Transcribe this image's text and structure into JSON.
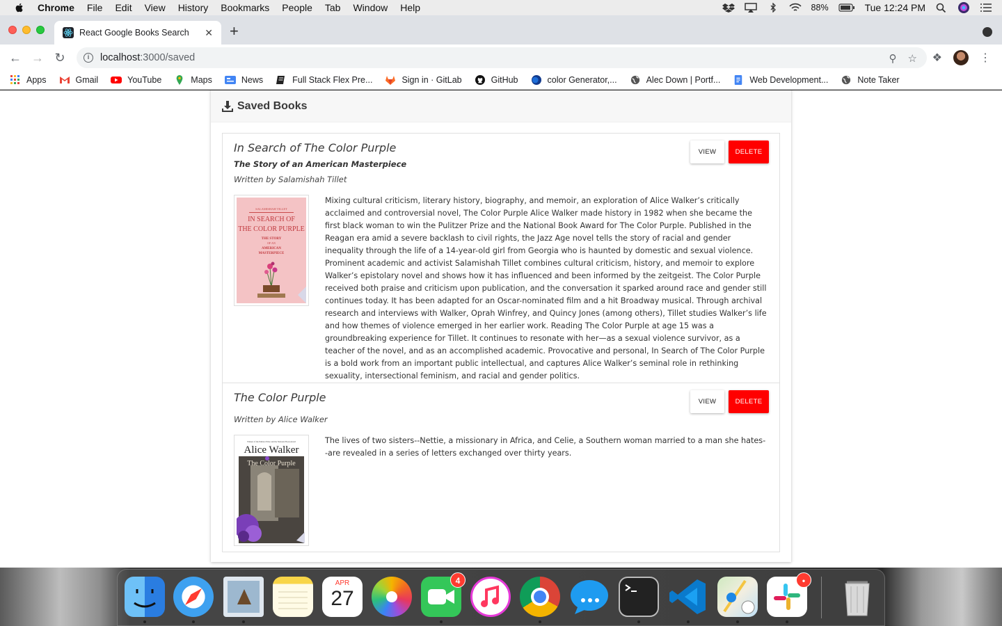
{
  "menubar": {
    "app": "Chrome",
    "items": [
      "File",
      "Edit",
      "View",
      "History",
      "Bookmarks",
      "People",
      "Tab",
      "Window",
      "Help"
    ],
    "battery": "88%",
    "clock": "Tue 12:24 PM"
  },
  "tab": {
    "title": "React Google Books Search",
    "close": "✕"
  },
  "toolbar": {
    "url_host": "localhost",
    "url_path": ":3000/saved"
  },
  "bookmarks": [
    {
      "label": "Apps",
      "icon": "apps-grid-icon"
    },
    {
      "label": "Gmail",
      "icon": "gmail-icon"
    },
    {
      "label": "YouTube",
      "icon": "youtube-icon"
    },
    {
      "label": "Maps",
      "icon": "maps-pin-icon"
    },
    {
      "label": "News",
      "icon": "news-icon"
    },
    {
      "label": "Full Stack Flex Pre...",
      "icon": "notebook-icon"
    },
    {
      "label": "Sign in · GitLab",
      "icon": "gitlab-icon"
    },
    {
      "label": "GitHub",
      "icon": "github-icon"
    },
    {
      "label": "color Generator,...",
      "icon": "color-circle-icon"
    },
    {
      "label": "Alec Down | Portf...",
      "icon": "globe-icon"
    },
    {
      "label": "Web Development...",
      "icon": "doc-icon"
    },
    {
      "label": "Note Taker",
      "icon": "globe-icon"
    }
  ],
  "page": {
    "header": "Saved Books",
    "books": [
      {
        "title": "In Search of The Color Purple",
        "subtitle": "The Story of an American Masterpiece",
        "author": "Written by Salamishah Tillet",
        "description": "Mixing cultural criticism, literary history, biography, and memoir, an exploration of Alice Walker’s critically acclaimed and controversial novel, The Color Purple Alice Walker made history in 1982 when she became the first black woman to win the Pulitzer Prize and the National Book Award for The Color Purple. Published in the Reagan era amid a severe backlash to civil rights, the Jazz Age novel tells the story of racial and gender inequality through the life of a 14-year-old girl from Georgia who is haunted by domestic and sexual violence. Prominent academic and activist Salamishah Tillet combines cultural criticism, history, and memoir to explore Walker’s epistolary novel and shows how it has influenced and been informed by the zeitgeist. The Color Purple received both praise and criticism upon publication, and the conversation it sparked around race and gender still continues today. It has been adapted for an Oscar-nominated film and a hit Broadway musical. Through archival research and interviews with Walker, Oprah Winfrey, and Quincy Jones (among others), Tillet studies Walker’s life and how themes of violence emerged in her earlier work. Reading The Color Purple at age 15 was a groundbreaking experience for Tillet. It continues to resonate with her—as a sexual violence survivor, as a teacher of the novel, and as an accomplished academic. Provocative and personal, In Search of The Color Purple is a bold work from an important public intellectual, and captures Alice Walker’s seminal role in rethinking sexuality, intersectional feminism, and racial and gender politics.",
        "cover": {
          "line1": "SALAMISHAH TILLET",
          "line2": "IN SEARCH OF",
          "line3": "THE COLOR PURPLE",
          "line4": "THE STORY",
          "line5": "OF AN",
          "line6": "AMERICAN",
          "line7": "MASTERPIECE"
        },
        "view_label": "VIEW",
        "delete_label": "DELETE"
      },
      {
        "title": "The Color Purple",
        "subtitle": "",
        "author": "Written by Alice Walker",
        "description": "The lives of two sisters--Nettie, a missionary in Africa, and Celie, a Southern woman married to a man she hates--are revealed in a series of letters exchanged over thirty years.",
        "cover": {
          "line1": "Winner of the Pulitzer Prize and the National Book Award",
          "line2": "Alice Walker",
          "line3": "The Color Purple"
        },
        "view_label": "VIEW",
        "delete_label": "DELETE"
      }
    ]
  },
  "dock": {
    "items": [
      "finder-icon",
      "safari-icon",
      "mail-icon",
      "notes-icon",
      "calendar-icon",
      "photos-icon",
      "facetime-icon",
      "music-icon",
      "chrome-icon",
      "messages-icon",
      "terminal-icon",
      "vscode-icon",
      "maps-icon",
      "slack-icon",
      "trash-icon"
    ],
    "calendar_month": "APR",
    "calendar_day": "27",
    "facetime_badge": "4"
  },
  "colors": {
    "delete": "#ff0000",
    "accent": "#1a73e8"
  }
}
